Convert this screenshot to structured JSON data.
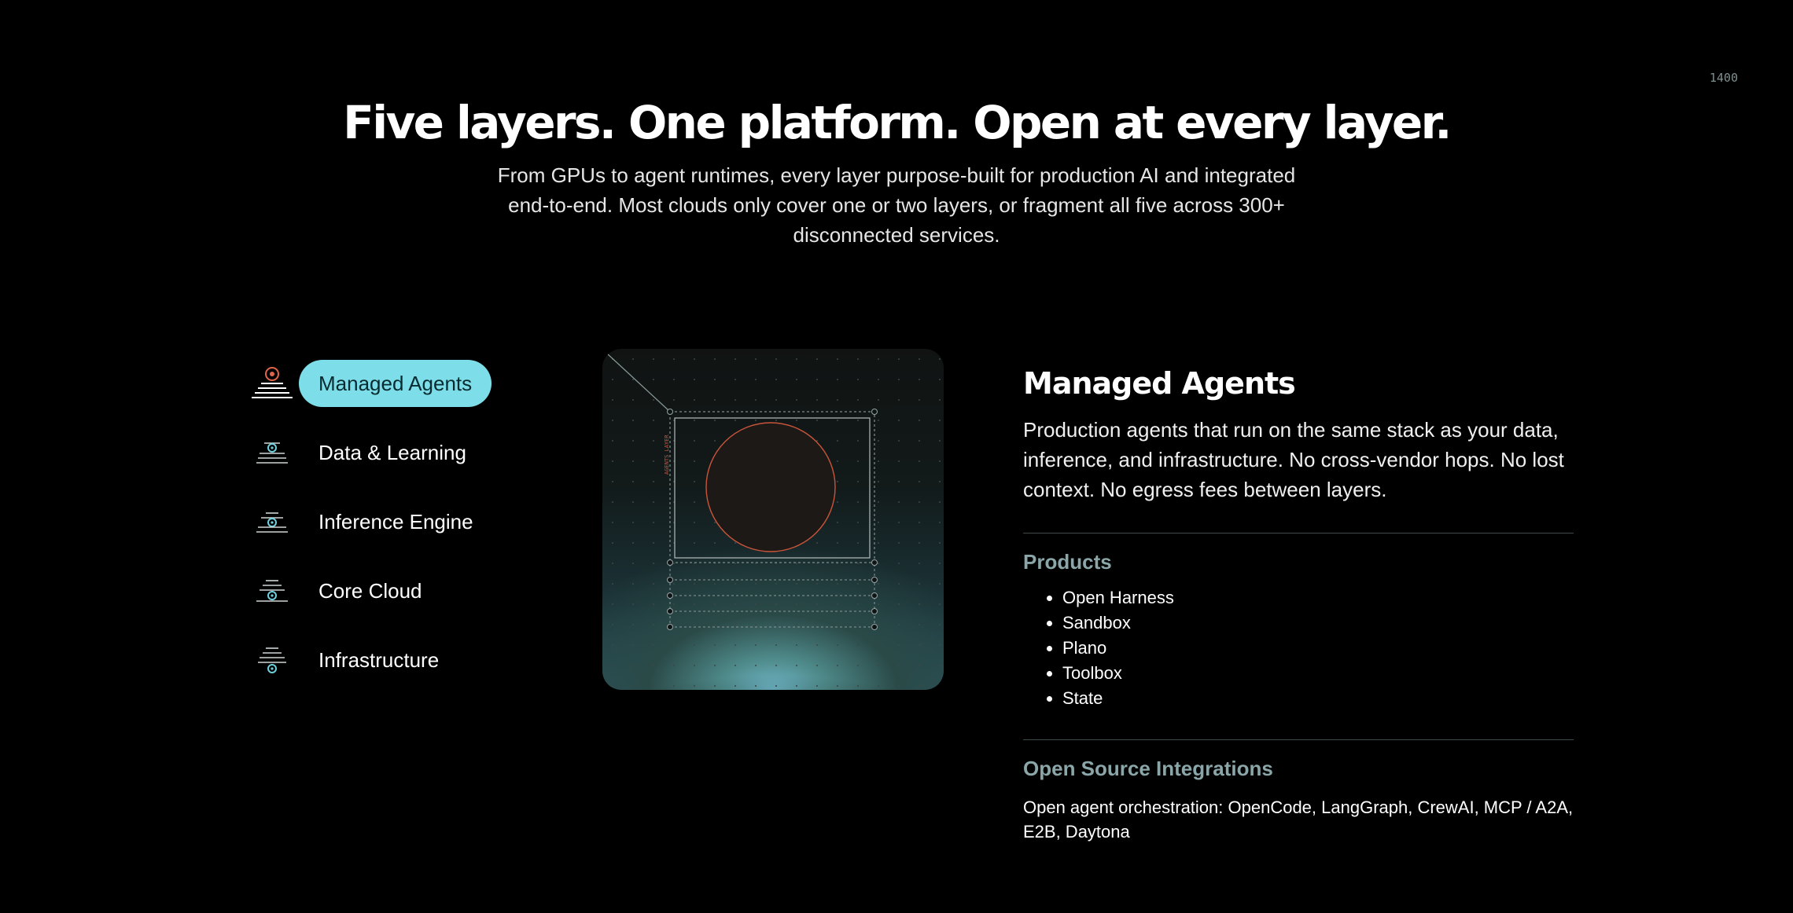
{
  "corner_label": "1400",
  "hero": {
    "title": "Five layers. One platform. Open at every layer.",
    "subtitle": "From GPUs to agent runtimes, every layer purpose-built for production AI and integrated end-to-end. Most clouds only cover one or two layers, or fragment all five across 300+ disconnected services."
  },
  "nav": {
    "items": [
      {
        "label": "Managed Agents",
        "icon": "layers-stack-icon-top",
        "active": true
      },
      {
        "label": "Data & Learning",
        "icon": "layers-stack-icon-second",
        "active": false
      },
      {
        "label": "Inference Engine",
        "icon": "layers-stack-icon-middle",
        "active": false
      },
      {
        "label": "Core Cloud",
        "icon": "layers-stack-icon-fourth",
        "active": false
      },
      {
        "label": "Infrastructure",
        "icon": "layers-stack-icon-bottom",
        "active": false
      }
    ]
  },
  "visual": {
    "vertical_label": "AGENTS LAYER"
  },
  "detail": {
    "title": "Managed Agents",
    "description": "Production agents that run on the same stack as your data, inference, and infrastructure. No cross-vendor hops. No lost context. No egress fees between layers.",
    "products_title": "Products",
    "products": [
      "Open Harness",
      "Sandbox",
      "Plano",
      "Toolbox",
      "State"
    ],
    "oss_title": "Open Source Integrations",
    "oss_text": "Open agent orchestration: OpenCode, LangGraph, CrewAI, MCP / A2A, E2B, Daytona"
  },
  "colors": {
    "background": "#000000",
    "accent": "#7ddde8",
    "active_text": "#062b30",
    "icon_active": "#e0654a",
    "icon_cyan": "#6fd0dc",
    "muted_heading": "#8aa6a8",
    "circle_stroke": "#c8553a"
  }
}
